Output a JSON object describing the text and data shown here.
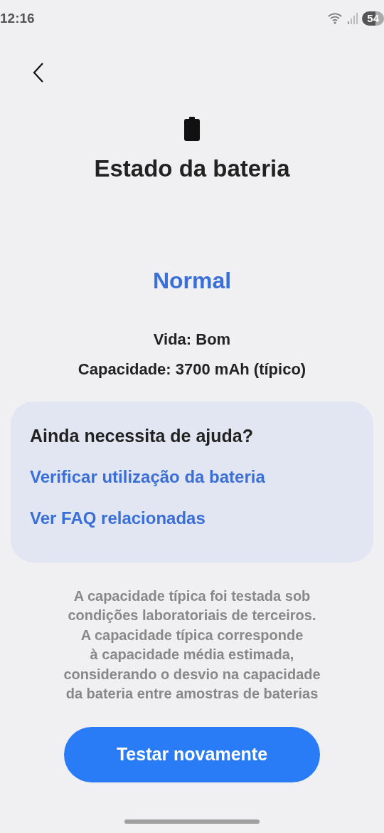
{
  "status_bar": {
    "time": "12:16",
    "battery": "54"
  },
  "title": "Estado da bateria",
  "status": "Normal",
  "details": [
    "Vida: Bom",
    "Capacidade: 3700 mAh (típico)"
  ],
  "help": {
    "title": "Ainda necessita de ajuda?",
    "links": [
      "Verificar utilização da bateria",
      "Ver FAQ relacionadas"
    ]
  },
  "note_lines": [
    "A capacidade típica foi testada sob",
    "condições laboratoriais de terceiros.",
    "A capacidade típica corresponde",
    "à capacidade média estimada,",
    "considerando o desvio na capacidade",
    "da bateria entre amostras de baterias"
  ],
  "button": "Testar novamente"
}
